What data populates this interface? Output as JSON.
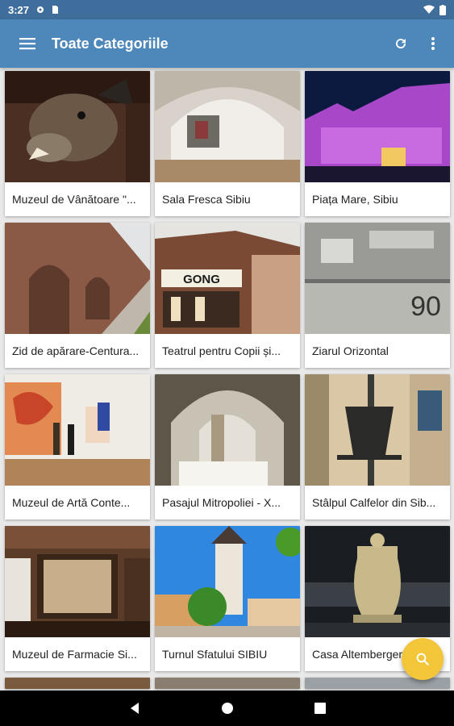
{
  "status": {
    "time": "3:27"
  },
  "app_bar": {
    "title": "Toate Categoriile"
  },
  "items": [
    {
      "label": "Muzeul de Vânătoare \"..."
    },
    {
      "label": "Sala Fresca Sibiu"
    },
    {
      "label": "Piața Mare, Sibiu"
    },
    {
      "label": "Zid de apărare-Centura..."
    },
    {
      "label": "Teatrul pentru Copii și..."
    },
    {
      "label": "Ziarul Orizontal"
    },
    {
      "label": "Muzeul de Artă Conte..."
    },
    {
      "label": "Pasajul Mitropoliei - X..."
    },
    {
      "label": "Stâlpul Calfelor din Sib..."
    },
    {
      "label": "Muzeul de Farmacie Si..."
    },
    {
      "label": "Turnul Sfatului SIBIU"
    },
    {
      "label": "Casa Altemberger"
    }
  ],
  "image_text": {
    "gong_sign": "GONG"
  },
  "colors": {
    "status_bar": "#3f6e9c",
    "app_bar": "#4e87ba",
    "fab": "#f3c538",
    "background": "#e9e9e9"
  },
  "icons": {
    "menu": "hamburger-icon",
    "refresh": "refresh-icon",
    "more": "more-vert-icon",
    "fab": "search-icon"
  }
}
